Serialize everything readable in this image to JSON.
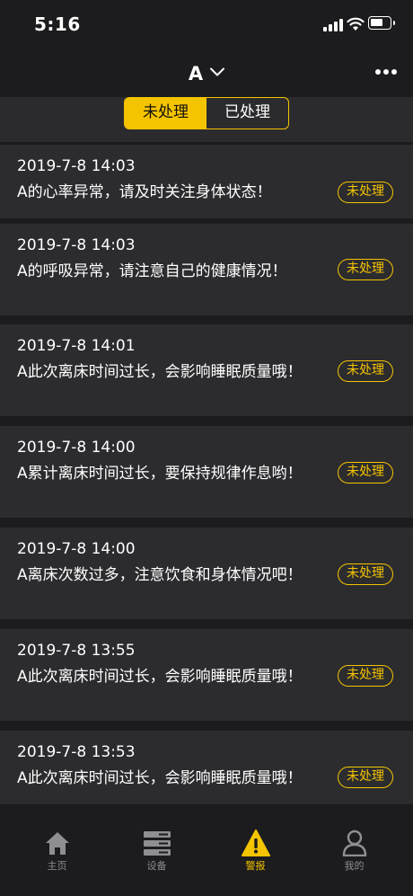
{
  "status": {
    "time": "5:16"
  },
  "nav": {
    "title": "A"
  },
  "segment": {
    "unprocessed": "未处理",
    "processed": "已处理"
  },
  "alerts": [
    {
      "time": "2019-7-8 14:03",
      "message": "A的心率异常，请及时关注身体状态！",
      "status": "未处理"
    },
    {
      "time": "2019-7-8 14:03",
      "message": "A的呼吸异常，请注意自己的健康情况！",
      "status": "未处理"
    },
    {
      "time": "2019-7-8 14:01",
      "message": "A此次离床时间过长，会影响睡眠质量哦！",
      "status": "未处理"
    },
    {
      "time": "2019-7-8 14:00",
      "message": "A累计离床时间过长，要保持规律作息哟！",
      "status": "未处理"
    },
    {
      "time": "2019-7-8 14:00",
      "message": "A离床次数过多，注意饮食和身体情况吧！",
      "status": "未处理"
    },
    {
      "time": "2019-7-8 13:55",
      "message": "A此次离床时间过长，会影响睡眠质量哦！",
      "status": "未处理"
    },
    {
      "time": "2019-7-8 13:53",
      "message": "A此次离床时间过长，会影响睡眠质量哦！",
      "status": "未处理"
    }
  ],
  "tabs": [
    {
      "label": "主页",
      "icon": "home-icon"
    },
    {
      "label": "设备",
      "icon": "device-icon"
    },
    {
      "label": "警报",
      "icon": "alert-icon",
      "active": true
    },
    {
      "label": "我的",
      "icon": "profile-icon"
    }
  ],
  "colors": {
    "accent": "#f5c400",
    "background": "#1c1c1e",
    "card": "#2c2c2f"
  }
}
